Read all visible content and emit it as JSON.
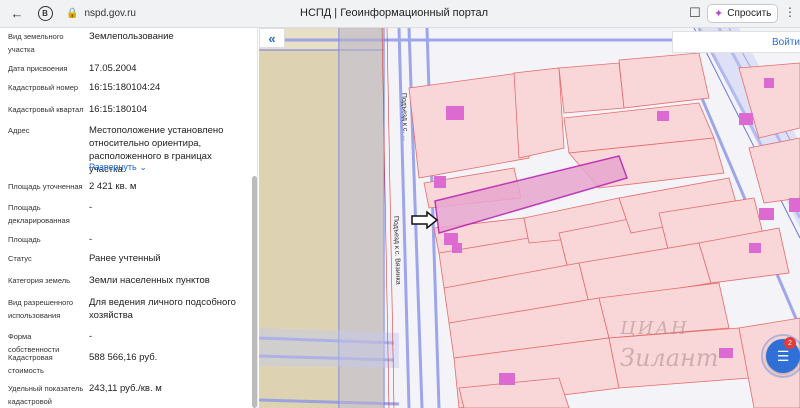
{
  "browser": {
    "url": "nspd.gov.ru",
    "page_title": "НСПД | Геоинформационный портал",
    "ask_label": "Спросить"
  },
  "info": {
    "rows": [
      {
        "label": "Вид земельного участка",
        "value": "Землепользование"
      },
      {
        "label": "Дата присвоения",
        "value": "17.05.2004"
      },
      {
        "label": "Кадастровый номер",
        "value": "16:15:180104:24"
      },
      {
        "label": "Кадастровый квартал",
        "value": "16:15:180104"
      },
      {
        "label": "Адрес",
        "value": "Местоположение установлено относительно ориентира, расположенного в границах участка."
      },
      {
        "label": "Площадь уточненная",
        "value": "2 421 кв. м"
      },
      {
        "label": "Площадь декларированная",
        "value": "-"
      },
      {
        "label": "Площадь",
        "value": "-"
      },
      {
        "label": "Статус",
        "value": "Ранее учтенный"
      },
      {
        "label": "Категория земель",
        "value": "Земли населенных пунктов"
      },
      {
        "label": "Вид разрешенного использования",
        "value": "Для ведения личного подсобного хозяйства"
      },
      {
        "label": "Форма собственности",
        "value": "-"
      },
      {
        "label": "Кадастровая стоимость",
        "value": "588 566,16 руб."
      },
      {
        "label": "Удельный показатель кадастровой",
        "value": "243,11 руб./кв. м"
      }
    ],
    "expand_label": "Развернуть"
  },
  "map": {
    "login_label": "Войти",
    "street_top": "Подъезд к с. ...",
    "street_mid": "Подъезд к с. Вязинка",
    "fab_badge": "2"
  },
  "watermark": {
    "top": "ЦИАН",
    "bottom": "Зилант"
  },
  "colors": {
    "accent": "#2f6fd6",
    "parcel_fill": "#f9d6d8",
    "parcel_stroke": "#e56c6c",
    "selected_fill": "#e8a6cf",
    "selected_stroke": "#b51cb0",
    "building": "#dd6ad1",
    "road": "#8f99e8"
  }
}
